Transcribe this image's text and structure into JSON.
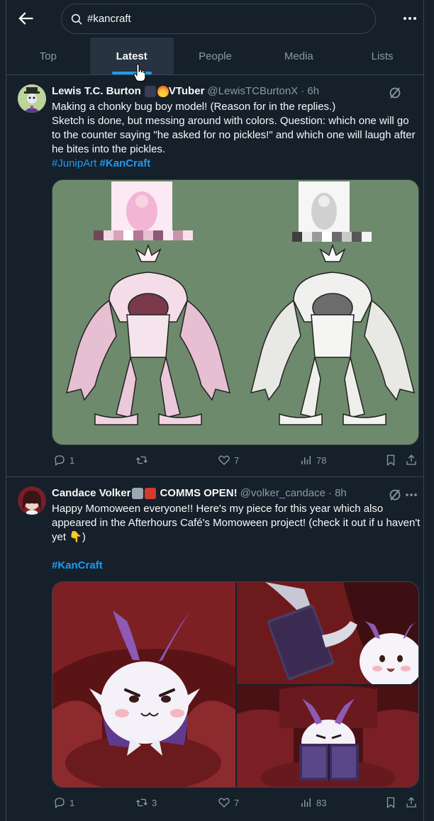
{
  "search": {
    "query": "#kancraft"
  },
  "tabs": [
    {
      "label": "Top",
      "active": false
    },
    {
      "label": "Latest",
      "active": true
    },
    {
      "label": "People",
      "active": false
    },
    {
      "label": "Media",
      "active": false
    },
    {
      "label": "Lists",
      "active": false
    }
  ],
  "tweets": [
    {
      "name": "Lewis T.C. Burton",
      "name_suffix": "VTuber",
      "handle": "@LewisTCBurtonX",
      "time": "· 6h",
      "lines": [
        "Making a chonky bug boy model! (Reason for in the replies.)",
        "Sketch is done, but messing around with colors. Question: which one will go to the counter saying \"he asked for no pickles!\" and which one will laugh after he bites into the pickles."
      ],
      "tags": [
        "#JunipArt",
        "#KanCraft"
      ],
      "stats": {
        "replies": "1",
        "reposts": "",
        "likes": "7",
        "views": "78"
      }
    },
    {
      "name": "Candace Volker",
      "name_suffix": "COMMS OPEN!",
      "handle": "@volker_candace",
      "time": "· 8h",
      "lines": [
        "Happy Momoween everyone!! Here's my piece for this year which also appeared in the Afterhours Café's Momoween project! (check it out if u haven't yet 👇)"
      ],
      "tags": [
        "#KanCraft"
      ],
      "stats": {
        "replies": "1",
        "reposts": "3",
        "likes": "7",
        "views": "83"
      }
    }
  ],
  "colors": {
    "background": "#15202b",
    "accent": "#1d9bf0",
    "muted": "#8b98a5",
    "border": "#38444d",
    "art_bg": "#6e8a6c"
  },
  "icons": [
    "back-arrow-icon",
    "search-icon",
    "more-icon",
    "grok-icon",
    "reply-icon",
    "repost-icon",
    "like-icon",
    "views-icon",
    "bookmark-icon",
    "share-icon",
    "hand-cursor-icon"
  ]
}
